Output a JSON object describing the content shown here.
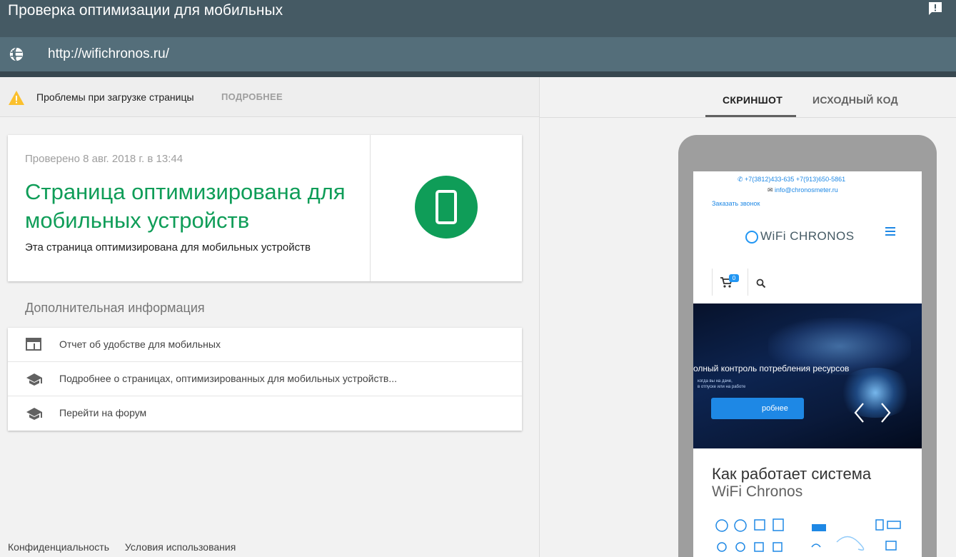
{
  "header": {
    "title": "Проверка оптимизации для мобильных",
    "url": "http://wifichronos.ru/"
  },
  "warning": {
    "text": "Проблемы при загрузке страницы",
    "more_label": "ПОДРОБНЕЕ"
  },
  "result": {
    "checked_at": "Проверено 8 авг. 2018 г. в 13:44",
    "headline": "Страница оптимизирована для мобильных устройств",
    "subtitle": "Эта страница оптимизирована для мобильных устройств"
  },
  "more_info": {
    "title": "Дополнительная информация",
    "links": [
      {
        "label": "Отчет об удобстве для мобильных",
        "icon": "web-layout-icon"
      },
      {
        "label": "Подробнее о страницах, оптимизированных для мобильных устройств...",
        "icon": "school-cap-icon"
      },
      {
        "label": "Перейти на форум",
        "icon": "school-cap-icon"
      }
    ]
  },
  "footer": {
    "privacy": "Конфиденциальность",
    "terms": "Условия использования"
  },
  "tabs": {
    "screenshot": "СКРИНШОТ",
    "source": "ИСХОДНЫЙ КОД"
  },
  "preview": {
    "phones": "+7(3812)433-635    +7(913)650-5861",
    "email": "info@chronosmeter.ru",
    "callback": "Заказать звонок",
    "logo": "WiFi CHRONOS",
    "cart_count": "0",
    "hero_title": "олный контроль потребления ресурсов",
    "hero_sub1": "когда вы на даче,",
    "hero_sub2": "в отпуске или на работе",
    "hero_button": "робнее",
    "how_title_1": "Как работает система",
    "how_title_2": "WiFi Chronos"
  },
  "colors": {
    "header_bg": "#455a64",
    "url_bg": "#546e7a",
    "success_green": "#0f9d58",
    "warning_yellow": "#fbc02d",
    "accent_blue": "#1e88e5"
  }
}
